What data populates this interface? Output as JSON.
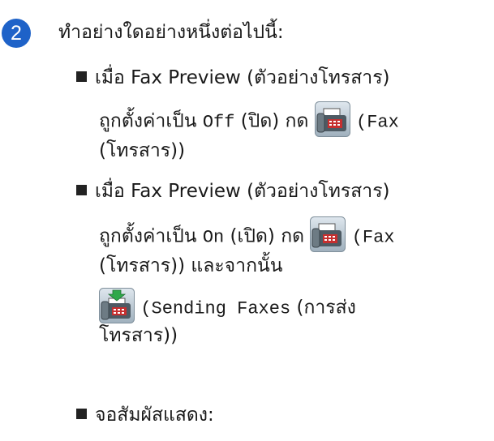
{
  "step": {
    "number": "2",
    "text": "ทำอย่างใดอย่างหนึ่งต่อไปนี้:"
  },
  "bullet1": {
    "line1": "เมื่อ Fax Preview (ตัวอย่างโทรสาร)",
    "line2_a": "ถูกตั้งค่าเป็น",
    "line2_mono": "Off",
    "line2_b": "(ปิด) กด",
    "line2_mono_c": "(Fax",
    "line3": "(โทรสาร))"
  },
  "bullet2": {
    "line1": "เมื่อ Fax Preview (ตัวอย่างโทรสาร)",
    "line2_a": "ถูกตั้งค่าเป็น",
    "line2_mono": "On",
    "line2_b": "(เปิด) กด",
    "line2_mono_c": "(Fax",
    "line3": "(โทรสาร)) และจากนั้น",
    "line4_mono": "(Sending Faxes",
    "line4_b": "(การส่ง",
    "line5": "โทรสาร))"
  },
  "bullet3": {
    "text": "จอสัมผัสแสดง:"
  },
  "icons": {
    "fax": "fax-icon",
    "sending_faxes": "sending-faxes-icon"
  },
  "colors": {
    "step_badge": "#1e62c8"
  }
}
